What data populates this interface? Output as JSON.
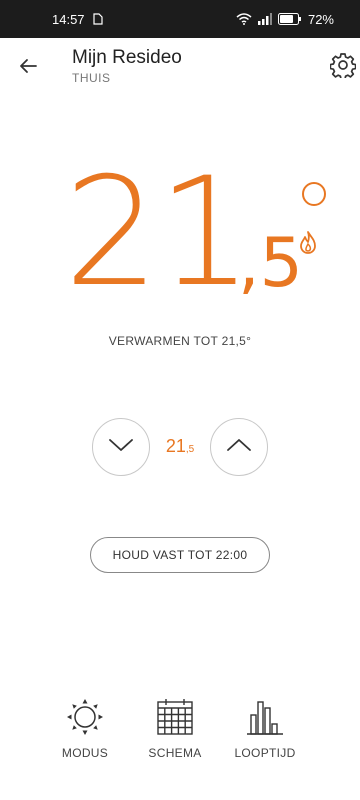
{
  "status_bar": {
    "time": "14:57",
    "battery_percent": "72%",
    "icons": [
      "sim-icon",
      "wifi-icon",
      "signal-icon",
      "battery-icon"
    ]
  },
  "header": {
    "title": "Mijn Resideo",
    "subtitle": "THUIS",
    "back_icon": "back-arrow-icon",
    "settings_icon": "gear-icon"
  },
  "temperature": {
    "integer": "21",
    "decimal": ",5",
    "heating_icon": "flame-icon",
    "accent_color": "#e87722"
  },
  "mode_text": "VERWARMEN TOT 21,5°",
  "setpoint": {
    "integer": "21",
    "decimal": ",5",
    "decrease_icon": "chevron-down-icon",
    "increase_icon": "chevron-up-icon"
  },
  "hold_button": "HOUD VAST TOT 22:00",
  "nav": [
    {
      "label": "MODUS",
      "icon": "sun-icon"
    },
    {
      "label": "SCHEMA",
      "icon": "calendar-icon"
    },
    {
      "label": "LOOPTIJD",
      "icon": "bar-chart-icon"
    }
  ]
}
